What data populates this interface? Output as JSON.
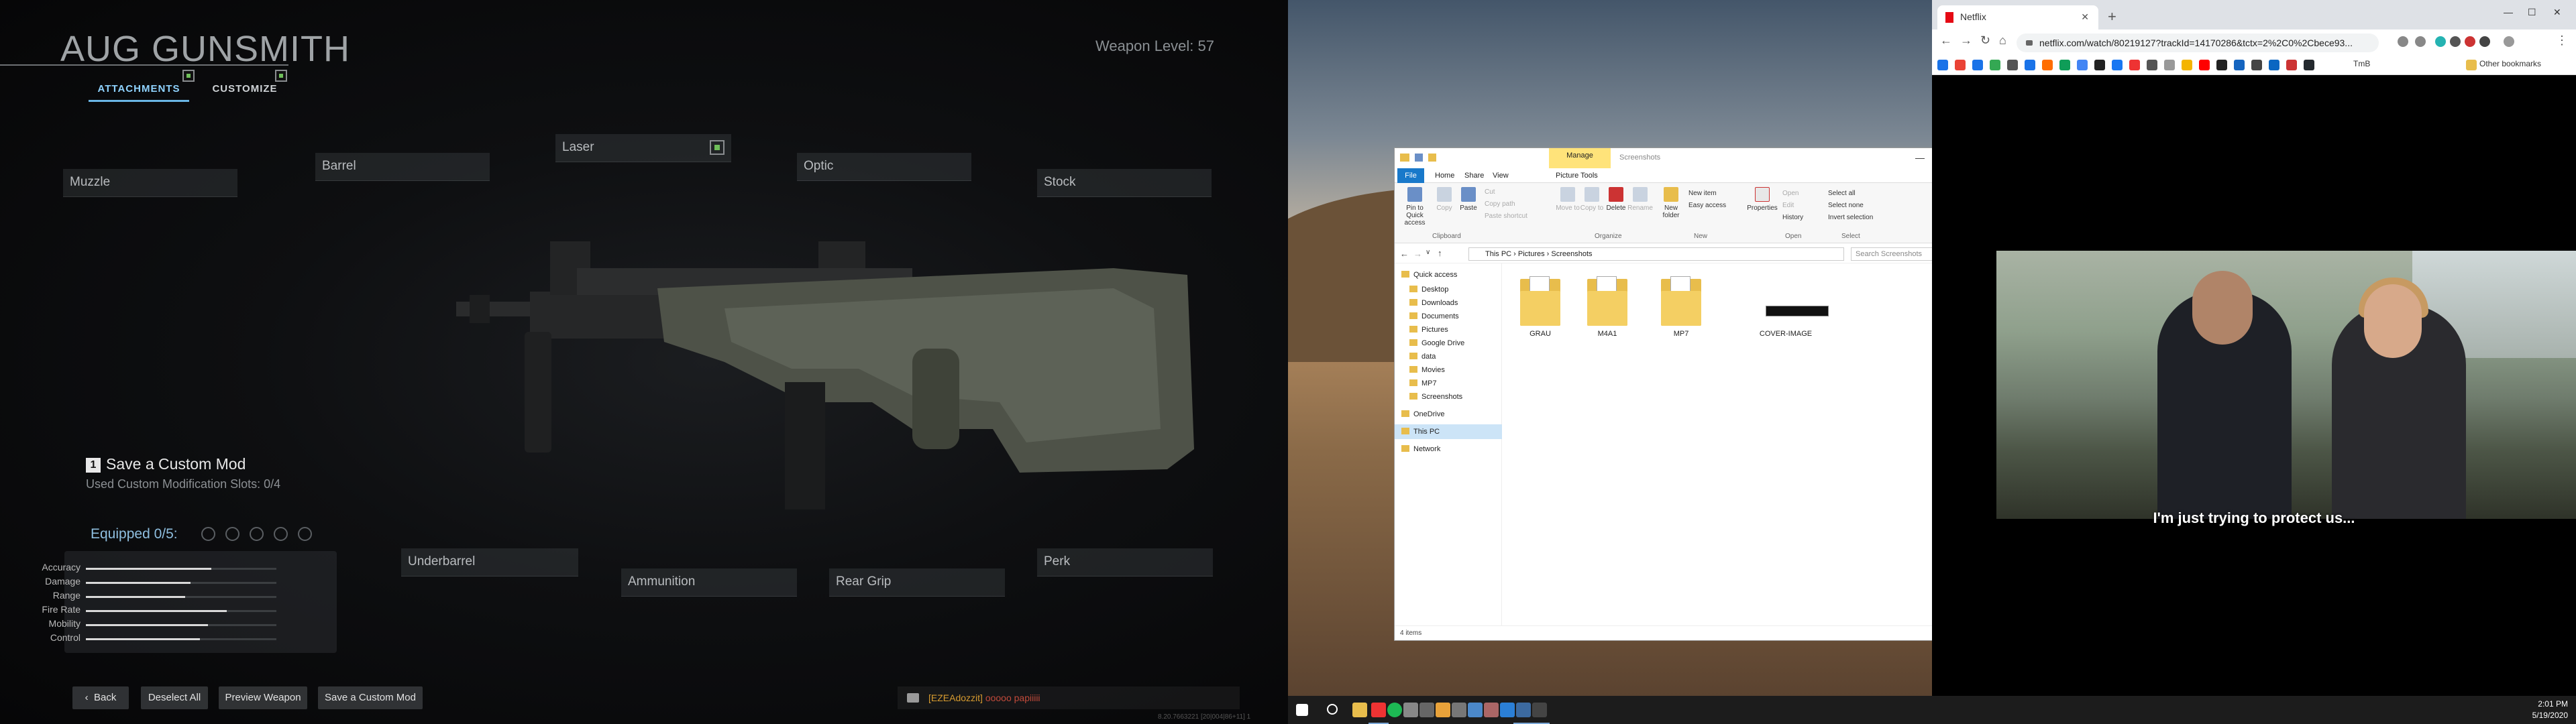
{
  "game": {
    "title": "AUG GUNSMITH",
    "tabs": [
      {
        "label": "ATTACHMENTS"
      },
      {
        "label": "CUSTOMIZE"
      }
    ],
    "weapon_level": "Weapon Level: 57",
    "slots": {
      "muzzle": "Muzzle",
      "barrel": "Barrel",
      "laser": "Laser",
      "optic": "Optic",
      "stock": "Stock",
      "underbarrel": "Underbarrel",
      "ammunition": "Ammunition",
      "rear_grip": "Rear Grip",
      "perk": "Perk"
    },
    "save_mod": {
      "key": "1",
      "label": "Save a Custom Mod",
      "slots_used": "Used Custom Modification Slots: 0/4"
    },
    "equipped": "Equipped 0/5:",
    "stats": [
      {
        "label": "Accuracy",
        "value": 0.66
      },
      {
        "label": "Damage",
        "value": 0.55
      },
      {
        "label": "Range",
        "value": 0.52
      },
      {
        "label": "Fire Rate",
        "value": 0.74
      },
      {
        "label": "Mobility",
        "value": 0.64
      },
      {
        "label": "Control",
        "value": 0.6
      }
    ],
    "buttons": {
      "back": "Back",
      "deselect": "Deselect All",
      "preview": "Preview Weapon",
      "save": "Save a Custom Mod"
    },
    "chat": {
      "tag": "[EZEAdozzit]",
      "message": "ooooo papiiiii"
    },
    "version": "8.20.7663221 [20|004|86+11] 1"
  },
  "explorer": {
    "manage": "Manage",
    "title": "Screenshots",
    "menu": {
      "file": "File",
      "home": "Home",
      "share": "Share",
      "view": "View",
      "picture_tools": "Picture Tools"
    },
    "ribbon": {
      "pin": "Pin to Quick access",
      "copy": "Copy",
      "paste": "Paste",
      "cut": "Cut",
      "copy_path": "Copy path",
      "paste_shortcut": "Paste shortcut",
      "move_to": "Move to",
      "copy_to": "Copy to",
      "delete": "Delete",
      "rename": "Rename",
      "new_folder": "New folder",
      "new_item": "New item",
      "easy_access": "Easy access",
      "properties": "Properties",
      "open": "Open",
      "edit": "Edit",
      "history": "History",
      "select_all": "Select all",
      "select_none": "Select none",
      "invert": "Invert selection",
      "groups": {
        "clipboard": "Clipboard",
        "organize": "Organize",
        "new": "New",
        "open": "Open",
        "select": "Select"
      }
    },
    "path": "This PC  ›  Pictures  ›  Screenshots",
    "search_placeholder": "Search Screenshots",
    "nav": [
      "Quick access",
      "Desktop",
      "Downloads",
      "Documents",
      "Pictures",
      "Google Drive",
      "data",
      "Movies",
      "MP7",
      "Screenshots",
      "OneDrive",
      "This PC",
      "Network"
    ],
    "items": [
      "GRAU",
      "M4A1",
      "MP7",
      "COVER-IMAGE"
    ],
    "status": "4 items"
  },
  "browser": {
    "tab_title": "Netflix",
    "url": "netflix.com/watch/80219127?trackId=14170286&tctx=2%2C0%2Cbece93...",
    "bookmarks_other": "Other bookmarks",
    "bookmark_text": "TmB",
    "subtitle": "I'm just trying to protect us..."
  },
  "taskbar": {
    "time": "2:01 PM",
    "date": "5/19/2020"
  }
}
